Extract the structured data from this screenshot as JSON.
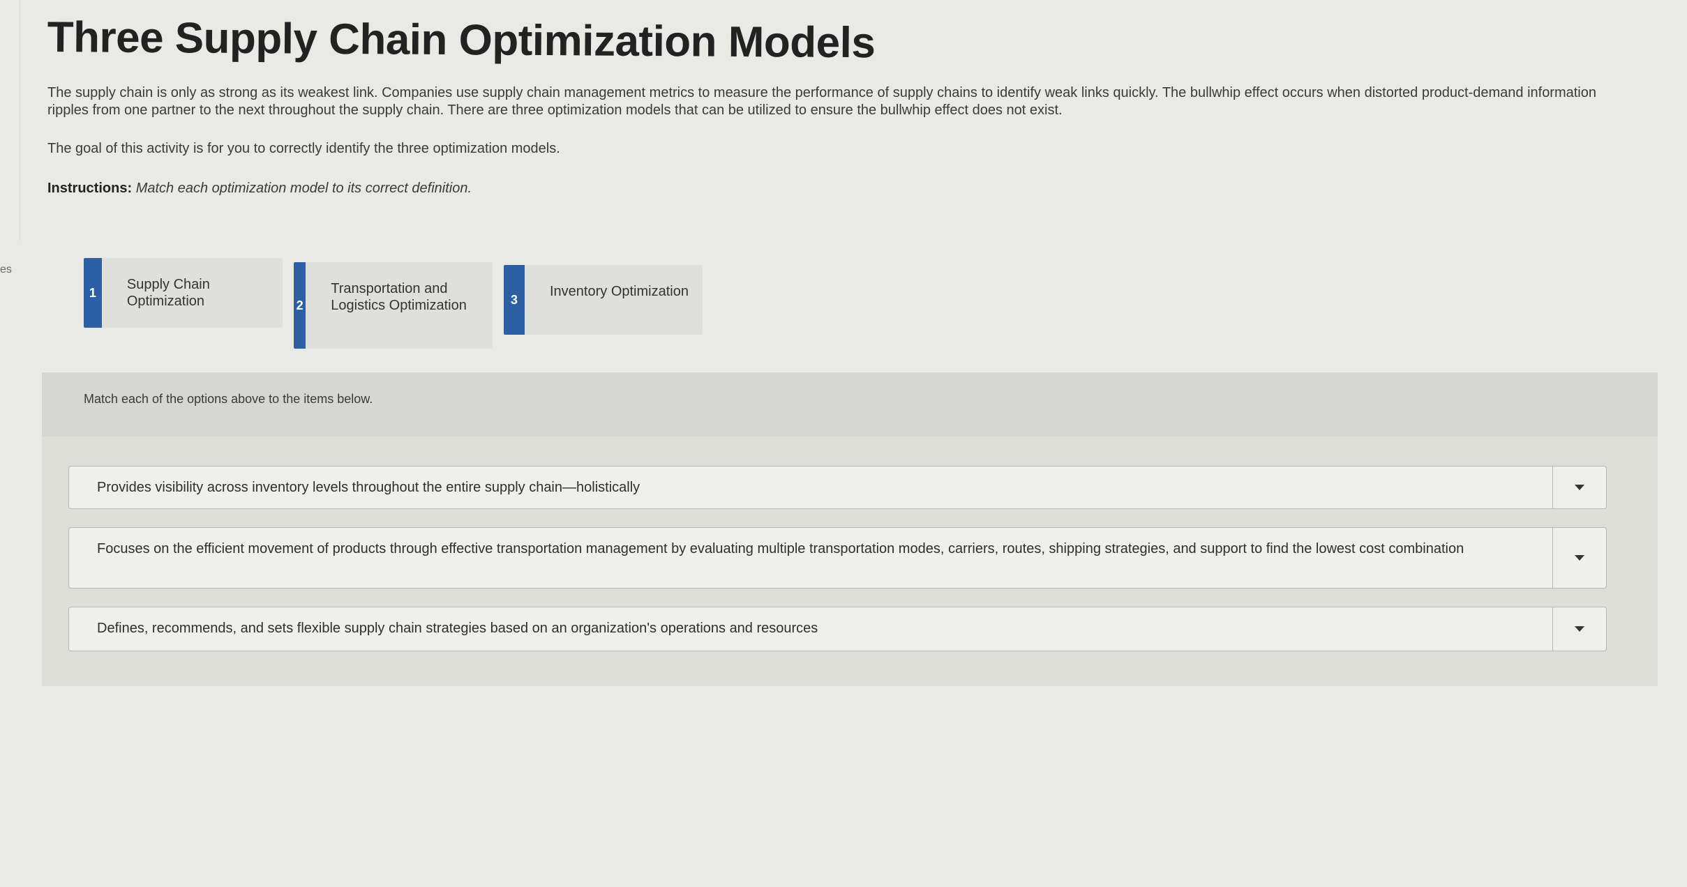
{
  "page": {
    "title": "Three Supply Chain Optimization Models",
    "intro": "The supply chain is only as strong as its weakest link. Companies use supply chain management metrics to measure the performance of supply chains to identify weak links quickly. The bullwhip effect occurs when distorted product-demand information ripples from one partner to the next throughout the supply chain. There are three optimization models that can be utilized to ensure the bullwhip effect does not exist.",
    "goal": "The goal of this activity is for you to correctly identify the three optimization models.",
    "instructions_label": "Instructions:",
    "instructions_text": "Match each optimization model to its correct definition.",
    "left_rail_text": "es"
  },
  "choices": [
    {
      "number": "1",
      "label": "Supply Chain Optimization"
    },
    {
      "number": "2",
      "label": "Transportation and Logistics Optimization"
    },
    {
      "number": "3",
      "label": "Inventory Optimization"
    }
  ],
  "match": {
    "header": "Match each of the options above to the items below.",
    "items": [
      {
        "text": "Provides visibility across inventory levels throughout the entire supply chain—holistically",
        "selected": ""
      },
      {
        "text": "Focuses on the efficient movement of products through effective transportation management by evaluating multiple transportation modes, carriers, routes, shipping strategies, and support to find the lowest cost combination",
        "selected": ""
      },
      {
        "text": "Defines, recommends, and sets flexible supply chain strategies based on an organization's operations and resources",
        "selected": ""
      }
    ]
  },
  "icons": {
    "dropdown": "chevron-down-icon"
  },
  "colors": {
    "accent": "#2d5fa5",
    "background": "#e9e9e6",
    "panel": "#deded9"
  }
}
